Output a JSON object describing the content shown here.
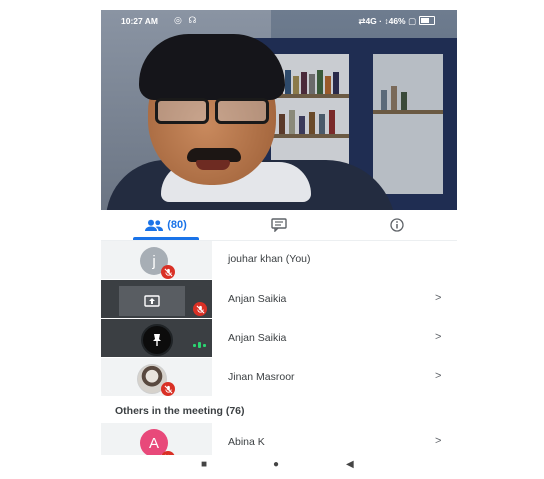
{
  "status_bar": {
    "time": "10:27 AM",
    "left_icons": "◎ ☊",
    "right_text": "⇄4G · ↕46% ▢"
  },
  "tabs": {
    "people_count": "(80)",
    "people_icon": "people-icon",
    "chat_icon": "chat-icon",
    "info_icon": "info-icon"
  },
  "participants": [
    {
      "name": "jouhar khan (You)",
      "avatar_letter": "j",
      "avatar_color": "#a7aeb5",
      "muted": true,
      "chevron": ""
    },
    {
      "name": "Anjan Saikia",
      "avatar_letter": "",
      "muted": true,
      "presenting": true,
      "chevron": ">"
    },
    {
      "name": "Anjan Saikia",
      "avatar_letter": "",
      "muted": false,
      "pinned": true,
      "chevron": ">"
    },
    {
      "name": "Jinan Masroor",
      "avatar_letter": "",
      "muted": true,
      "photo": true,
      "chevron": ">"
    }
  ],
  "others_header": "Others in the meeting (76)",
  "others": [
    {
      "name": "Abina K",
      "avatar_letter": "A",
      "avatar_color": "#e8497a",
      "muted": true,
      "chevron": ">"
    }
  ],
  "navbar": {
    "recents": "■",
    "home": "●",
    "back": "◀"
  },
  "colors": {
    "accent": "#1a73e8",
    "mute_red": "#d93025",
    "speaking_green": "#2bd471"
  }
}
